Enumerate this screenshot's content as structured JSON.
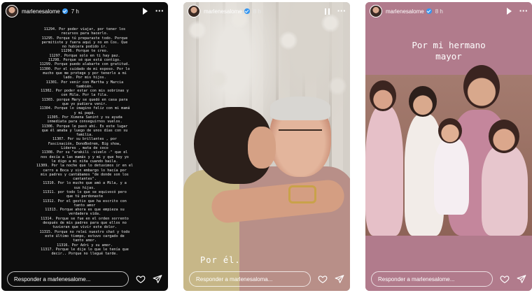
{
  "colors": {
    "story1_bg": "#0d0d0d",
    "story3_bg": "#b17b8c",
    "verified": "#3897f0"
  },
  "icons": [
    "verified-badge-icon",
    "play-icon",
    "pause-icon",
    "more-options-icon",
    "heart-icon",
    "send-icon"
  ],
  "stories": [
    {
      "username": "marlenesalome",
      "time": "7 h",
      "text": "11294. Por poder viajar, por tener los\nrecursos para hacerlo.\n11295. Porque tú preparaste todo. Porque\npermitiste y fuera aquí y no en Cos. Que\nno hubiera podido ir.\n11296. Porque te creo.\n11297. Porque solo en ti hay paz.\n11298. Porque sé que está contigo.\n11299. Porque puedo alabarte con gratitud.\n11300. Por el cuidado de mi esposo. Por lo\nmucho que me protege y por tenerlo a mi\nlado. Por mis hijos.\n11301. Por venir con Martha y Marcia\ntambién.\n11302. Por poder estar con mis sobrinas y\ncon Mila. Por la fila.\n11303. porque Mary se quedó en casa para\nque yo pudiera venir.\n11304. Porque lo imagino feliz con mi mamá\ny mi papá.\n11305. Por Ximena Sanint y su ayuda\ninmediata para conseguirnos vuelos.\n11306. Porque le pasó ahí. Es este lugar\nque él amaba y luego de unos días con su\nfamilia.\n11307. Por su brillantes , por\nFascinación, DonoBodrem, Big show,\nLíderes , mata de coco\n11308. Por su \"arakili -vivelo -\" que el\nnos decía a las mamás y y mi y que hoy yo\nle digo a mi niña cuando baila.\n11309. Por la noche que lo detuvimos ir en el\ncarro a Boca y sin embargo lo hacía por\nmis padres y cantábamos \"de donde son los\ncantantes\".\n11310. Por lo mucho que amó a Mila, y a\nsus hijas.\n11311. por todo lo que se equivocó pero\nque tú perdonaste\n11312. Por el gestio que ha escrito con\ntanto amor\n11313. Porque ahora es que empieza su\nverdadera vida.\n11314. Porque se fue en el orden sorrento\ndespués de mis padres para que ellos no\ntuvieran que vivir este dolor.\n11315. Porque no relei nuestro chat y todo\neste último tiempo, estuvo cargado de\ntanto amor.\n11316. Por Adri y su amor.\n11317. Porque le dije lo que le tenía que\ndecir.. Porque no llegué tarde.",
      "reply_placeholder": "Responder a marlenesalome..."
    },
    {
      "username": "marlenesalome",
      "time": "8 h",
      "caption": "Por él.",
      "reply_placeholder": "Responder a marlenesaloma..."
    },
    {
      "username": "marlenesalome",
      "time": "8 h",
      "caption": "Por mi hermano\nmayor",
      "reply_placeholder": "Responder a marlenesalome..."
    }
  ]
}
